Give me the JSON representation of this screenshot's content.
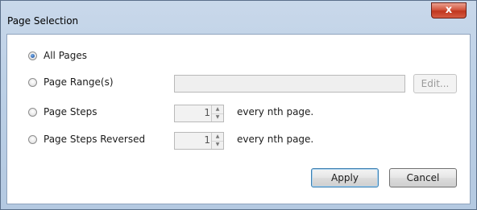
{
  "window": {
    "title": "Page Selection",
    "close_label": "x"
  },
  "options": [
    {
      "label": "All Pages",
      "selected": true
    },
    {
      "label": "Page Range(s)",
      "selected": false
    },
    {
      "label": "Page Steps",
      "selected": false
    },
    {
      "label": "Page Steps Reversed",
      "selected": false
    }
  ],
  "page_range": {
    "value": "",
    "edit_label": "Edit..."
  },
  "page_steps": {
    "value": "1",
    "suffix": "every nth page."
  },
  "page_steps_reversed": {
    "value": "1",
    "suffix": "every nth page."
  },
  "buttons": {
    "apply": "Apply",
    "cancel": "Cancel"
  },
  "icons": {
    "spin_up": "up-arrow-icon",
    "spin_down": "down-arrow-icon"
  }
}
